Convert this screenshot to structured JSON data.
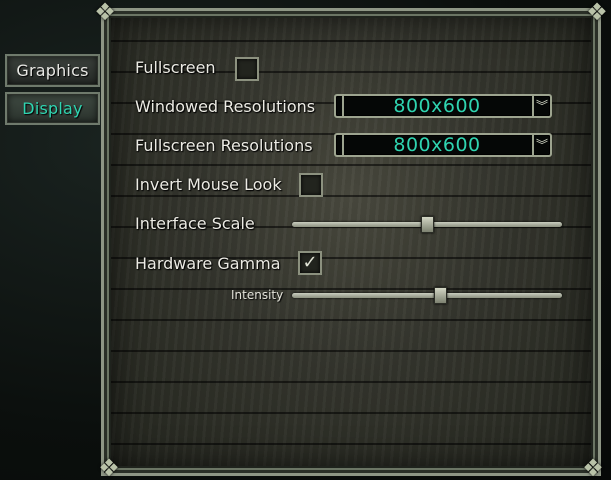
{
  "tabs": [
    {
      "label": "Graphics",
      "active": false
    },
    {
      "label": "Display",
      "active": true
    }
  ],
  "settings": {
    "fullscreen": {
      "label": "Fullscreen",
      "checked": false
    },
    "windowed_resolutions": {
      "label": "Windowed Resolutions",
      "value": "800x600"
    },
    "fullscreen_resolutions": {
      "label": "Fullscreen Resolutions",
      "value": "800x600"
    },
    "invert_mouse_look": {
      "label": "Invert Mouse Look",
      "checked": false
    },
    "interface_scale": {
      "label": "Interface Scale",
      "level": 0.5
    },
    "hardware_gamma": {
      "label": "Hardware Gamma",
      "checked": true,
      "check_glyph": "✓"
    },
    "intensity": {
      "label": "Intensity",
      "level": 0.55
    }
  },
  "icons": {
    "dropdown_arrow": "chevron-double-down-icon",
    "corner_ornament": "celtic-knot-icon"
  },
  "colors": {
    "accent_teal": "#2fd4b0",
    "label_text": "#ecebe4"
  }
}
